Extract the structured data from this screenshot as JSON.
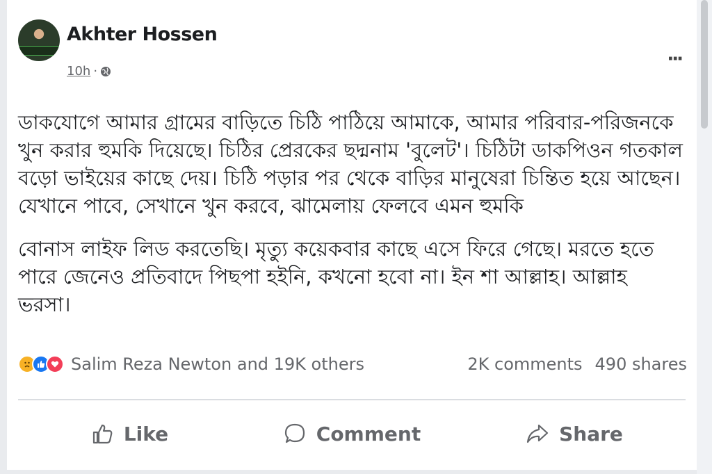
{
  "post": {
    "author": "Akhter Hossen",
    "time": "10h",
    "separator": "·",
    "more": "···",
    "body": [
      "ডাকযোগে আমার গ্রামের বাড়িতে চিঠি পাঠিয়ে আমাকে, আমার পরিবার-পরিজনকে খুন করার হুমকি দিয়েছে। চিঠির প্রেরকের ছদ্মনাম 'বুলেট'। চিঠিটা ডাকপিওন গতকাল বড়ো ভাইয়ের কাছে দেয়। চিঠি পড়ার পর থেকে বাড়ির মানুষেরা চিন্তিত হয়ে আছেন। যেখানে পাবে, সেখানে খুন করবে, ঝামেলায় ফেলবে এমন হুমকি",
      "বোনাস লাইফ লিড করতেছি। মৃত্যু কয়েকবার কাছে এসে ফিরে গেছে। মরতে হতে পারে জেনেও প্রতিবাদে পিছপা হইনি, কখনো হবো না। ইন শা আল্লাহ। আল্লাহ ভরসা।"
    ]
  },
  "reactions": {
    "icons": [
      "sad-icon",
      "like-icon",
      "love-icon"
    ],
    "summary": "Salim Reza Newton and 19K others"
  },
  "stats": {
    "comments": "2K comments",
    "shares": "490 shares"
  },
  "actions": {
    "like": "Like",
    "comment": "Comment",
    "share": "Share"
  },
  "colors": {
    "like_blue": "#1877f2",
    "love_red": "#f33e58",
    "sad_yellow": "#f7b125",
    "muted_text": "#65676b"
  }
}
